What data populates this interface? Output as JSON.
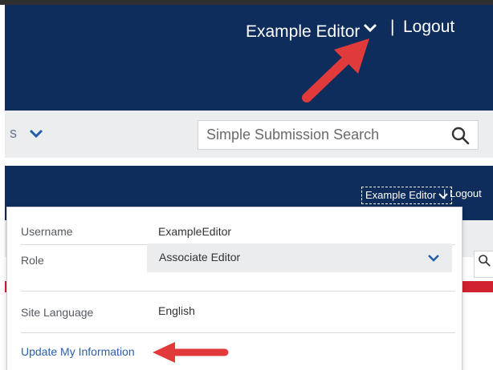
{
  "top_panel": {
    "user_name": "Example Editor",
    "separator": "|",
    "logout_label": "Logout",
    "search": {
      "placeholder": "Simple Submission Search",
      "value": ""
    },
    "nav_stub_text": "s"
  },
  "bottom_panel": {
    "user_name": "Example Editor",
    "separator": "|",
    "logout_label": "Logout",
    "menu": {
      "username_label": "Username",
      "username_value": "ExampleEditor",
      "role_label": "Role",
      "role_value": "Associate Editor",
      "language_label": "Site Language",
      "language_value": "English",
      "update_link": "Update My Information"
    }
  },
  "colors": {
    "navbar": "#0e2c5c",
    "subbar": "#ecedef",
    "link": "#2b5fa8",
    "annotation_arrow": "#e03a3a",
    "accent_bar": "#d02330"
  },
  "icons": [
    "chevron-down-icon",
    "search-icon",
    "annotation-arrow"
  ]
}
